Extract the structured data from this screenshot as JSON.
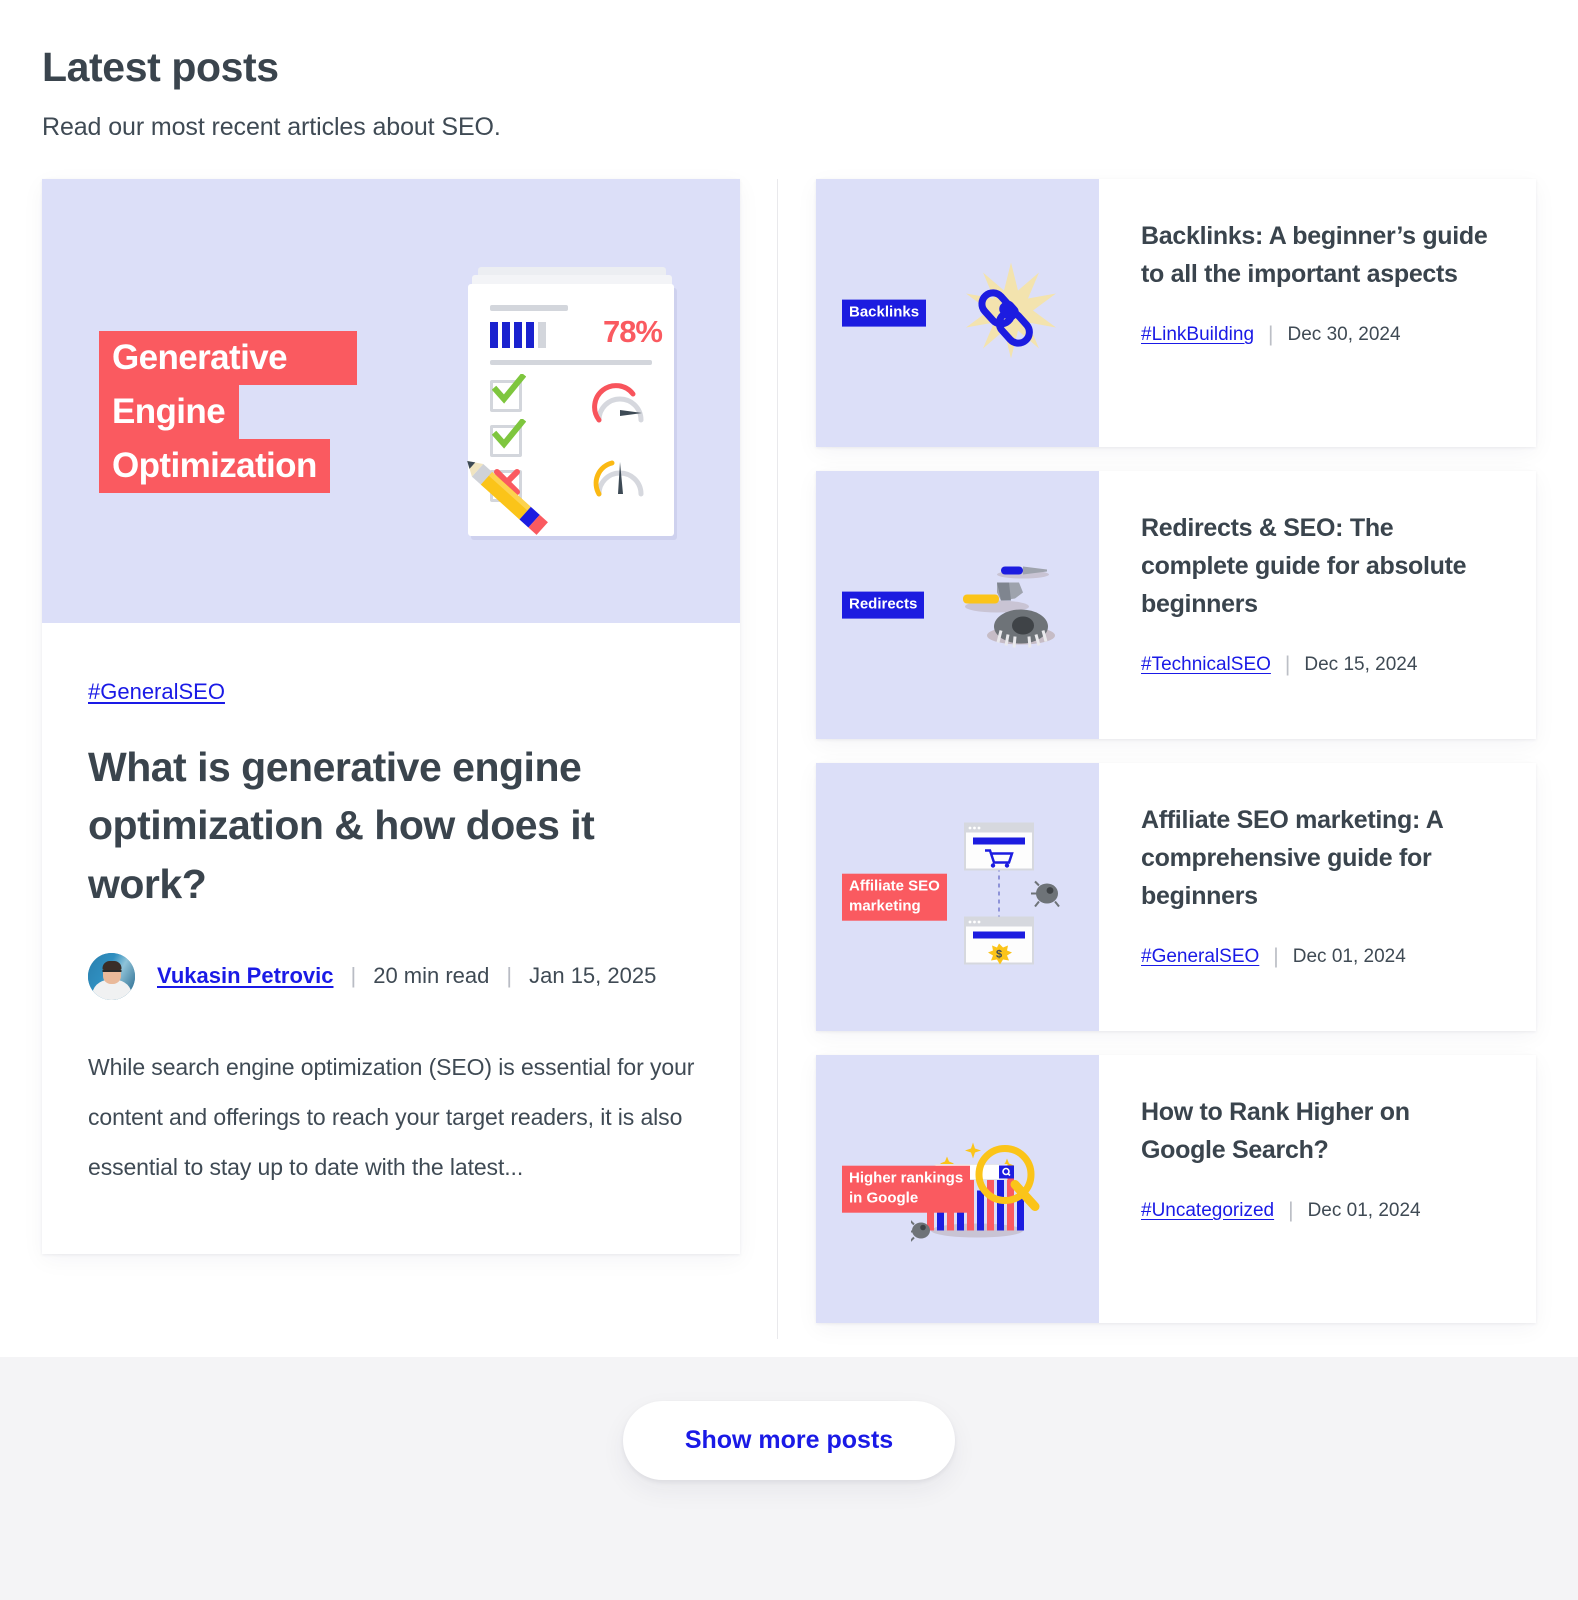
{
  "header": {
    "title": "Latest posts",
    "subtitle": "Read our most recent articles about SEO."
  },
  "colors": {
    "accent_blue": "#1a1ae6",
    "accent_red": "#fa5a60",
    "thumb_bg": "#dcdff8",
    "text_dark": "#3a444d",
    "footer_bg": "#f4f4f6"
  },
  "featured": {
    "hero": {
      "lines": [
        "Generative",
        "Engine",
        "Optimization"
      ],
      "report_percent": "78%"
    },
    "tag": "#GeneralSEO",
    "title": "What is generative engine optimization & how does it work?",
    "author": "Vukasin Petrovic",
    "read_time": "20 min read",
    "date": "Jan 15, 2025",
    "separator": "|",
    "excerpt": "While search engine optimization (SEO) is essential for your content and offerings to reach your target readers, it is also essential to stay up to date with the latest..."
  },
  "posts": [
    {
      "badge": "Backlinks",
      "badge_style": "blue",
      "art": "chain-link-burst",
      "title": "Backlinks: A beginner’s guide to all the important aspects",
      "tag": "#LinkBuilding",
      "separator": "|",
      "date": "Dec 30, 2024"
    },
    {
      "badge": "Redirects",
      "badge_style": "blue",
      "art": "hammer-screwdriver-manhole",
      "title": "Redirects & SEO: The complete guide for absolute beginners",
      "tag": "#TechnicalSEO",
      "separator": "|",
      "date": "Dec 15, 2024"
    },
    {
      "badge": "Affiliate SEO\nmarketing",
      "badge_style": "red",
      "art": "browser-cart-dollar",
      "title": "Affiliate SEO marketing: A comprehensive guide for beginners",
      "tag": "#GeneralSEO",
      "separator": "|",
      "date": "Dec 01, 2024"
    },
    {
      "badge": "Higher rankings\nin Google",
      "badge_style": "red",
      "art": "bar-chart-magnifier",
      "title": "How to Rank Higher on Google Search?",
      "tag": "#Uncategorized",
      "separator": "|",
      "date": "Dec 01, 2024"
    }
  ],
  "footer": {
    "show_more_label": "Show more posts"
  }
}
